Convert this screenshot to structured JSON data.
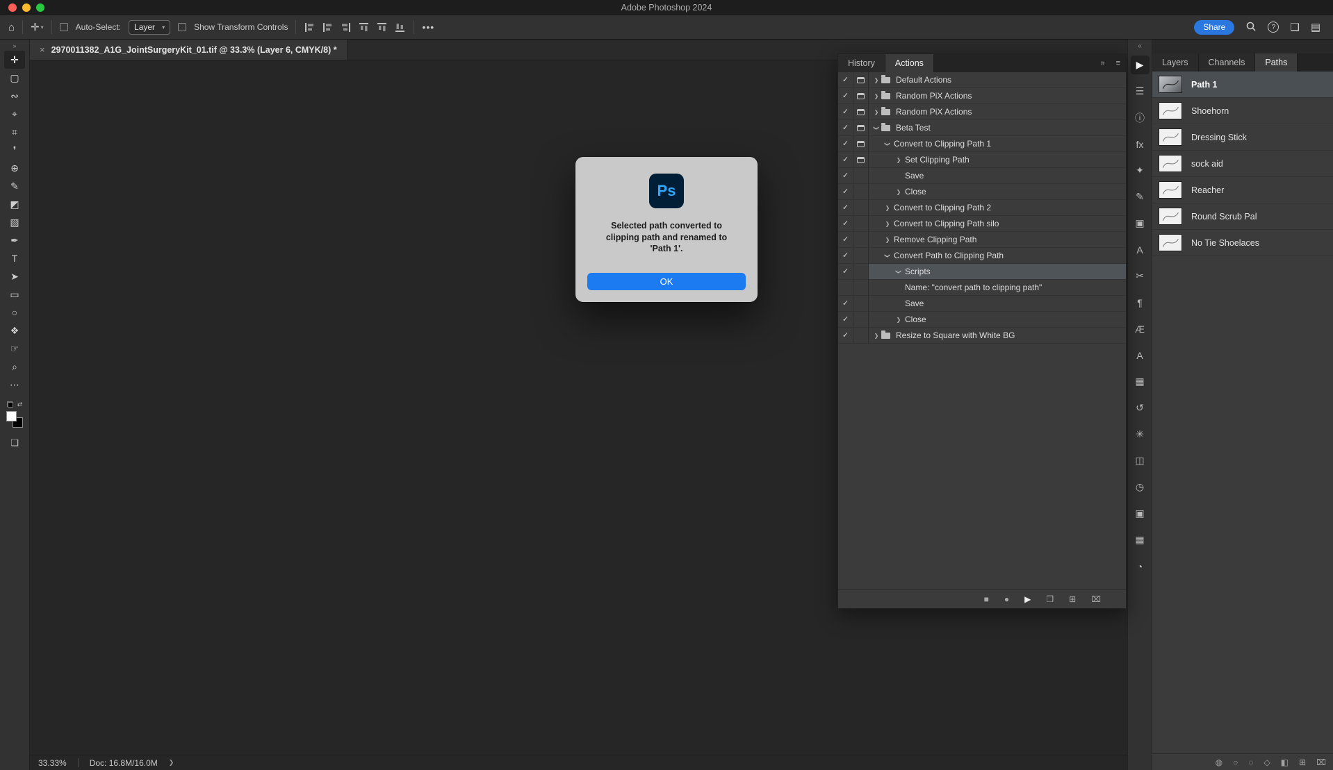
{
  "window": {
    "title": "Adobe Photoshop 2024"
  },
  "traffic_lights": {
    "close": "#ff5f57",
    "minimize": "#febc2e",
    "zoom": "#28c840"
  },
  "accent_blue": "#2b77e0",
  "options_bar": {
    "home_glyph": "⌂",
    "tool_preset_glyph": "✛",
    "caret_glyph": "▾",
    "auto_select_label": "Auto-Select:",
    "target_value": "Layer",
    "show_transform_label": "Show Transform Controls",
    "more_glyph": "•••",
    "share_label": "Share",
    "share_color": "#2b77e0",
    "help_glyph": "?",
    "arrange_glyph": "❏",
    "workspace_glyph": "▤",
    "align_icons": [
      "align-left-icon",
      "align-center-horizontal-icon",
      "align-right-icon",
      "align-top-icon",
      "align-middle-vertical-icon",
      "align-bottom-icon"
    ]
  },
  "document_tab": {
    "close_glyph": "×",
    "title": "2970011382_A1G_JointSurgeryKit_01.tif @ 33.3% (Layer 6, CMYK/8) *"
  },
  "toolbar": {
    "collapse_glyph": "»",
    "swap_glyph": "⇄",
    "screen_mode_glyph": "❏",
    "tools": [
      {
        "name": "move-tool",
        "glyph": "✛",
        "active": true
      },
      {
        "name": "marquee-tool",
        "glyph": "▢"
      },
      {
        "name": "lasso-tool",
        "glyph": "∾"
      },
      {
        "name": "quick-selection-tool",
        "glyph": "⌖"
      },
      {
        "name": "crop-tool",
        "glyph": "⌗"
      },
      {
        "name": "eyedropper-tool",
        "glyph": "❜"
      },
      {
        "name": "healing-brush-tool",
        "glyph": "⊕"
      },
      {
        "name": "brush-tool",
        "glyph": "✎"
      },
      {
        "name": "clone-stamp-tool",
        "glyph": "◩"
      },
      {
        "name": "gradient-tool",
        "glyph": "▨"
      },
      {
        "name": "pen-tool",
        "glyph": "✒"
      },
      {
        "name": "type-tool",
        "glyph": "T"
      },
      {
        "name": "path-selection-tool",
        "glyph": "➤"
      },
      {
        "name": "rectangle-tool",
        "glyph": "▭"
      },
      {
        "name": "ellipse-tool",
        "glyph": "○"
      },
      {
        "name": "custom-shape-tool",
        "glyph": "❖"
      },
      {
        "name": "hand-tool",
        "glyph": "☞"
      },
      {
        "name": "zoom-tool",
        "glyph": "⌕"
      },
      {
        "name": "more-tools",
        "glyph": "⋯"
      }
    ]
  },
  "color_swatches": {
    "foreground": "#ffffff",
    "background": "#000000"
  },
  "dialog": {
    "app_icon_label": "Ps",
    "message": "Selected path converted to clipping path and renamed to 'Path 1'.",
    "ok_label": "OK",
    "accent": "#1d7bf2"
  },
  "actions_panel": {
    "collapse_glyph": "»",
    "menu_glyph": "≡",
    "tabs": [
      {
        "label": "History",
        "active": false
      },
      {
        "label": "Actions",
        "active": true
      }
    ],
    "rows": [
      {
        "label": "Default Actions",
        "indent": 0,
        "checked": true,
        "modal": true,
        "arrow": "collapsed",
        "folder": true
      },
      {
        "label": "Random PiX Actions",
        "indent": 0,
        "checked": true,
        "modal": true,
        "arrow": "collapsed",
        "folder": true
      },
      {
        "label": "Random PiX Actions",
        "indent": 0,
        "checked": true,
        "modal": true,
        "arrow": "collapsed",
        "folder": true
      },
      {
        "label": "Beta Test",
        "indent": 0,
        "checked": true,
        "modal": true,
        "arrow": "expanded",
        "folder": true
      },
      {
        "label": "Convert to Clipping Path 1",
        "indent": 1,
        "checked": true,
        "modal": true,
        "arrow": "expanded"
      },
      {
        "label": "Set Clipping Path",
        "indent": 2,
        "checked": true,
        "modal": true,
        "arrow": "collapsed"
      },
      {
        "label": "Save",
        "indent": 2,
        "checked": true,
        "arrow": "none"
      },
      {
        "label": "Close",
        "indent": 2,
        "checked": true,
        "arrow": "collapsed"
      },
      {
        "label": "Convert to Clipping Path 2",
        "indent": 1,
        "checked": true,
        "arrow": "collapsed"
      },
      {
        "label": "Convert to Clipping Path silo",
        "indent": 1,
        "checked": true,
        "arrow": "collapsed"
      },
      {
        "label": "Remove Clipping Path",
        "indent": 1,
        "checked": true,
        "arrow": "collapsed"
      },
      {
        "label": "Convert Path to Clipping Path",
        "indent": 1,
        "checked": true,
        "arrow": "expanded"
      },
      {
        "label": "Scripts",
        "indent": 2,
        "checked": true,
        "arrow": "expanded",
        "selected": true
      },
      {
        "label": "Name:  \"convert path to clipping path\"",
        "indent": 2,
        "arrow": "none",
        "detail": true
      },
      {
        "label": "Save",
        "indent": 2,
        "checked": true,
        "arrow": "none"
      },
      {
        "label": "Close",
        "indent": 2,
        "checked": true,
        "arrow": "collapsed"
      },
      {
        "label": "Resize to Square with White BG",
        "indent": 0,
        "checked": true,
        "arrow": "collapsed",
        "folder": true
      }
    ],
    "footer_icons": [
      {
        "name": "stop-playing-icon",
        "glyph": "■"
      },
      {
        "name": "begin-recording-icon",
        "glyph": "●"
      },
      {
        "name": "play-selection-icon",
        "glyph": "▶",
        "active": true
      },
      {
        "name": "new-set-folder-icon",
        "glyph": "❐"
      },
      {
        "name": "new-action-icon",
        "glyph": "⊞"
      },
      {
        "name": "delete-action-icon",
        "glyph": "⌧"
      }
    ]
  },
  "panel_strip": {
    "collapse_glyph": "«",
    "icons": [
      {
        "name": "actions-panel-icon",
        "glyph": "▶",
        "active": true
      },
      {
        "name": "properties-panel-icon",
        "glyph": "☰"
      },
      {
        "name": "info-panel-icon",
        "glyph": "ⓘ"
      },
      {
        "name": "fx-panel-icon",
        "glyph": "fx"
      },
      {
        "name": "styles-panel-icon",
        "glyph": "✦"
      },
      {
        "name": "brush-settings-panel-icon",
        "glyph": "✎"
      },
      {
        "name": "layer-comps-panel-icon",
        "glyph": "▣"
      },
      {
        "name": "character-panel-icon",
        "glyph": "A"
      },
      {
        "name": "scissors-panel-icon",
        "glyph": "✂"
      },
      {
        "name": "paragraph-panel-icon",
        "glyph": "¶"
      },
      {
        "name": "glyphs-panel-icon",
        "glyph": "Æ"
      },
      {
        "name": "character-styles-panel-icon",
        "glyph": "A"
      },
      {
        "name": "swatches-panel-icon",
        "glyph": "▦"
      },
      {
        "name": "history-panel-icon",
        "glyph": "↺"
      },
      {
        "name": "settings-panel-icon",
        "glyph": "✳"
      },
      {
        "name": "libraries-panel-icon",
        "glyph": "◫"
      },
      {
        "name": "timeline-panel-icon",
        "glyph": "◷"
      },
      {
        "name": "navigator-panel-icon",
        "glyph": "▣"
      },
      {
        "name": "channels-panel-icon",
        "glyph": "▦"
      },
      {
        "name": "adjustments-panel-icon",
        "glyph": "◔"
      }
    ]
  },
  "paths_panel": {
    "tabs": [
      {
        "label": "Layers",
        "active": false
      },
      {
        "label": "Channels",
        "active": false
      },
      {
        "label": "Paths",
        "active": true
      }
    ],
    "rows": [
      {
        "label": "Path 1",
        "selected": true,
        "thumb": "image"
      },
      {
        "label": "Shoehorn",
        "thumb": "path"
      },
      {
        "label": "Dressing Stick",
        "thumb": "path"
      },
      {
        "label": "sock aid",
        "thumb": "path"
      },
      {
        "label": "Reacher",
        "thumb": "path"
      },
      {
        "label": "Round Scrub Pal",
        "thumb": "path"
      },
      {
        "label": "No Tie Shoelaces",
        "thumb": "path"
      }
    ],
    "footer_icons": [
      {
        "name": "fill-path-icon",
        "glyph": "◍"
      },
      {
        "name": "stroke-path-icon",
        "glyph": "○"
      },
      {
        "name": "load-path-as-selection-icon",
        "glyph": "◌"
      },
      {
        "name": "make-work-path-icon",
        "glyph": "◇"
      },
      {
        "name": "add-mask-icon",
        "glyph": "◧"
      },
      {
        "name": "new-path-icon",
        "glyph": "⊞"
      },
      {
        "name": "delete-path-icon",
        "glyph": "⌧"
      }
    ]
  },
  "status_bar": {
    "zoom": "33.33%",
    "doc_info": "Doc: 16.8M/16.0M",
    "chevron_glyph": "❯"
  }
}
